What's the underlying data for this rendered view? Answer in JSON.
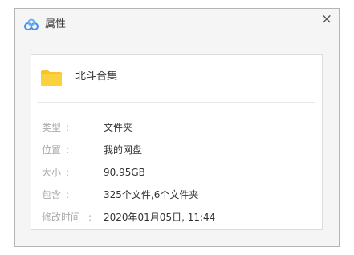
{
  "window": {
    "title": "属性",
    "close_glyph": "×",
    "app_icon": "baidu-netdisk-cloud-icon"
  },
  "file": {
    "icon": "folder-icon",
    "name": "北斗合集"
  },
  "properties": [
    {
      "label": "类型",
      "sep": ":",
      "value": "文件夹"
    },
    {
      "label": "位置",
      "sep": ":",
      "value": "我的网盘"
    },
    {
      "label": "大小",
      "sep": ":",
      "value": "90.95GB"
    },
    {
      "label": "包含",
      "sep": ":",
      "value": "325个文件,6个文件夹"
    },
    {
      "label": "修改时间",
      "sep": ":",
      "value": "2020年01月05日, 11:44"
    }
  ],
  "colors": {
    "folder": "#f7c42b",
    "cloud_blue": "#3b8ff5",
    "label_gray": "#a8a8a8"
  }
}
